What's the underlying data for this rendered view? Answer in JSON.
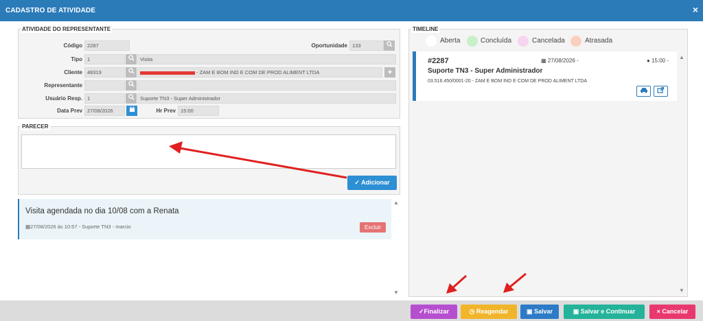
{
  "window": {
    "title": "CADASTRO DE ATIVIDADE",
    "close_icon": "×"
  },
  "atividade": {
    "legend": "ATIVIDADE DO REPRESENTANTE",
    "codigo": {
      "label": "Código",
      "value": "2287"
    },
    "oportunidade": {
      "label": "Oportunidade",
      "value": "133"
    },
    "tipo": {
      "label": "Tipo",
      "code": "1",
      "name": "Visita"
    },
    "cliente": {
      "label": "Cliente",
      "code": "48319",
      "name": "- ZAM E BOM IND E COM DE PROD ALIMENT LTDA"
    },
    "representante": {
      "label": "Representante",
      "code": "",
      "name": ""
    },
    "usuario": {
      "label": "Usuário Resp.",
      "code": "1",
      "name": "Suporte TN3 - Super Administrador"
    },
    "data_prev": {
      "label": "Data Prev",
      "value": "27/08/2026"
    },
    "hr_prev": {
      "label": "Hr Prev",
      "value": "15:00"
    }
  },
  "parecer": {
    "legend": "PARECER",
    "value": "",
    "add_label": "Adicionar"
  },
  "notes": [
    {
      "title": "Visita agendada no dia 10/08 com a Renata",
      "meta": "27/08/2026 às 10:57 - Suporte TN3 - marcio",
      "delete_label": "Excluir"
    }
  ],
  "timeline": {
    "legend": "TIMELINE",
    "legend_items": [
      {
        "label": "Aberta",
        "color": "#ffffff"
      },
      {
        "label": "Concluída",
        "color": "#c8f0c8"
      },
      {
        "label": "Cancelada",
        "color": "#f7d4ef"
      },
      {
        "label": "Atrasada",
        "color": "#f9d0c0"
      }
    ],
    "card": {
      "id": "#2287",
      "date": "27/08/2026 -",
      "time": "15:00 -",
      "user": "Suporte TN3 - Super Administrador",
      "client": "03.516.450/0001-20 - ZAM E BOM IND E COM DE PROD ALIMENT LTDA"
    }
  },
  "actions": {
    "finalizar": "Finalizar",
    "reagendar": "Reagendar",
    "salvar": "Salvar",
    "salvar_continuar": "Salvar e Continuar",
    "cancelar": "Cancelar"
  },
  "colors": {
    "header": "#2b7bb9",
    "finalizar": "#b64fcf",
    "reagendar": "#f1b52a",
    "salvar": "#2d7bc6",
    "salvar_continuar": "#24b39a",
    "cancelar": "#e9386e",
    "annotation_arrow": "#e02020"
  },
  "icons": {
    "search": "search-icon",
    "plus": "plus-icon",
    "calendar": "calendar-icon",
    "clock": "clock-icon",
    "check": "check-icon",
    "car": "car-icon",
    "share": "share-icon",
    "save": "floppy-icon",
    "times": "times-icon"
  }
}
